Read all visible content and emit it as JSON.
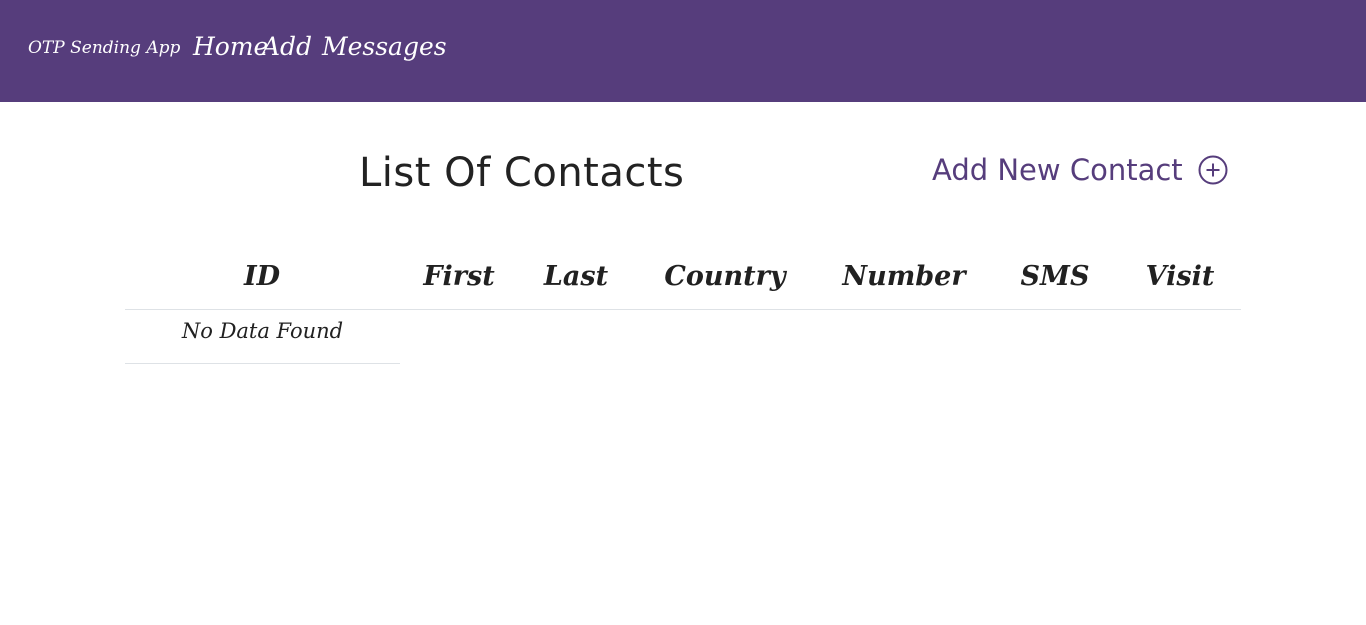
{
  "navbar": {
    "brand": "OTP Sending App",
    "links": [
      {
        "label": "Home"
      },
      {
        "label": "Add"
      },
      {
        "label": "Messages"
      }
    ],
    "background_color": "#563d7c"
  },
  "main": {
    "title": "List Of Contacts",
    "add_contact_label": "Add New Contact",
    "add_contact_icon": "plus-circle-icon",
    "accent_color": "#563d7c"
  },
  "table": {
    "columns": [
      "ID",
      "First",
      "Last",
      "Country",
      "Number",
      "SMS",
      "Visit"
    ],
    "empty_message": "No Data Found"
  }
}
